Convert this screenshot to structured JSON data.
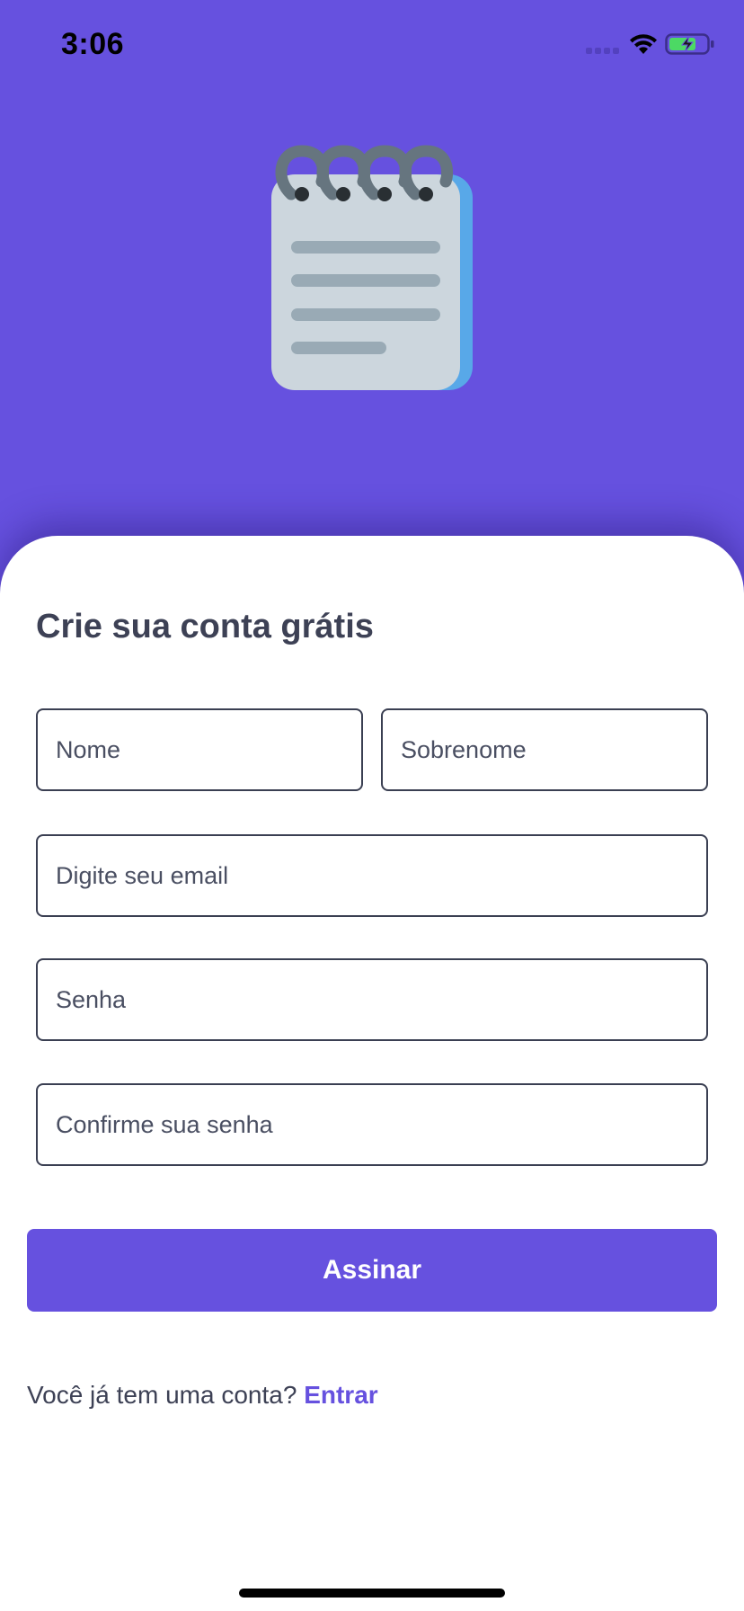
{
  "status_bar": {
    "time": "3:06",
    "icons": [
      "cellular-signal-icon",
      "wifi-icon",
      "battery-charging-icon"
    ]
  },
  "hero": {
    "icon": "notepad-icon"
  },
  "form": {
    "title": "Crie sua conta grátis",
    "first_name_placeholder": "Nome",
    "last_name_placeholder": "Sobrenome",
    "email_placeholder": "Digite seu email",
    "password_placeholder": "Senha",
    "confirm_password_placeholder": "Confirme sua senha",
    "submit_label": "Assinar"
  },
  "footer": {
    "prompt": "Você já tem uma conta?",
    "login_link": "Entrar"
  },
  "colors": {
    "primary": "#6651df",
    "text": "#3d4155",
    "border": "#3a3f52",
    "battery_fill": "#4cd964"
  }
}
